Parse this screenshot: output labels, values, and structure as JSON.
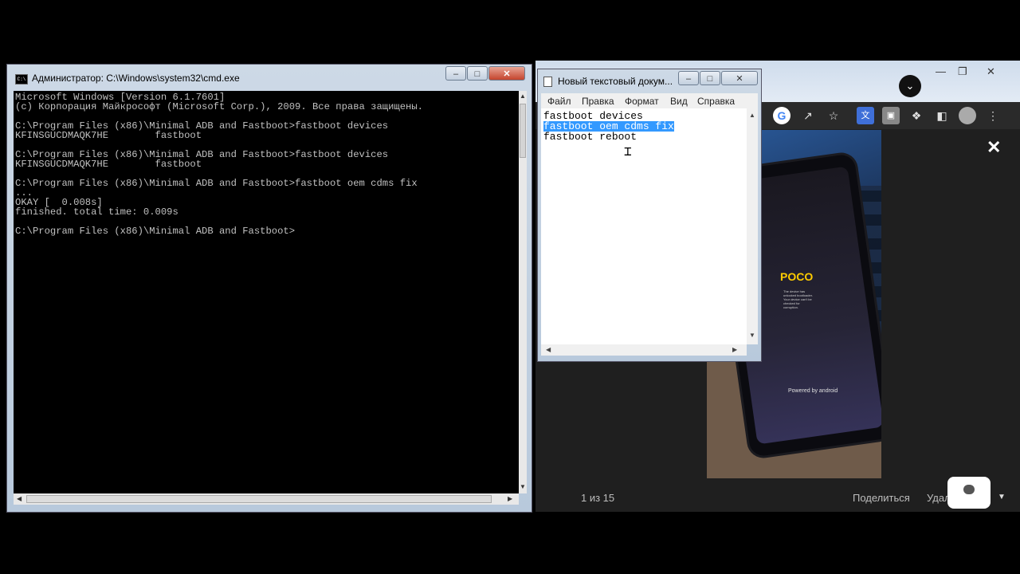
{
  "browser": {
    "page_counter": "1 из 15",
    "share_label": "Поделиться",
    "delete_label": "Удалить",
    "google_icon": "G",
    "photo": {
      "brand_text": "POCO",
      "small_text": "The device has unlocked bootloader. Your device can't be checked for corruption.",
      "powered_text": "Powered by android"
    }
  },
  "cmd": {
    "title": "Администратор: C:\\Windows\\system32\\cmd.exe",
    "lines": [
      "Microsoft Windows [Version 6.1.7601]",
      "(c) Корпорация Майкрософт (Microsoft Corp.), 2009. Все права защищены.",
      "",
      "C:\\Program Files (x86)\\Minimal ADB and Fastboot>fastboot devices",
      "KFINSGUCDMAQK7HE        fastboot",
      "",
      "C:\\Program Files (x86)\\Minimal ADB and Fastboot>fastboot devices",
      "KFINSGUCDMAQK7HE        fastboot",
      "",
      "C:\\Program Files (x86)\\Minimal ADB and Fastboot>fastboot oem cdms fix",
      "...",
      "OKAY [  0.008s]",
      "finished. total time: 0.009s",
      "",
      "C:\\Program Files (x86)\\Minimal ADB and Fastboot>"
    ]
  },
  "notepad": {
    "title": "Новый текстовый докум...",
    "menu": [
      "Файл",
      "Правка",
      "Формат",
      "Вид",
      "Справка"
    ],
    "lines": [
      "fastboot devices",
      "fastboot oem cdms fix",
      "fastboot reboot"
    ]
  }
}
